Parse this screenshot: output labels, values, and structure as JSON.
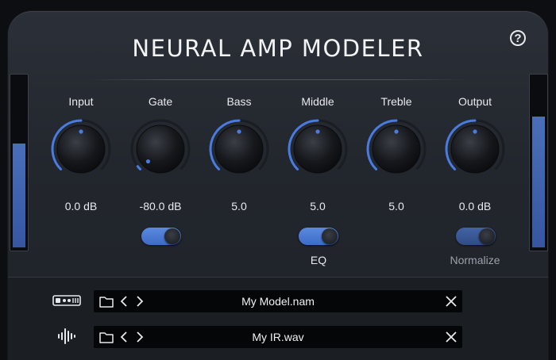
{
  "app": {
    "title": "NEURAL AMP MODELER",
    "help_glyph": "?"
  },
  "colors": {
    "accent": "#4a7be0",
    "knob_arc": "#4a7be0",
    "meter_fill": "#3d5fab",
    "background": "#22262d"
  },
  "meters": {
    "input_level": 0.62,
    "output_level": 0.78
  },
  "knobs": [
    {
      "label": "Input",
      "value": "0.0 dB",
      "level": 0.5
    },
    {
      "label": "Gate",
      "value": "-80.0 dB",
      "level": 0.0
    },
    {
      "label": "Bass",
      "value": "5.0",
      "level": 0.5
    },
    {
      "label": "Middle",
      "value": "5.0",
      "level": 0.5
    },
    {
      "label": "Treble",
      "value": "5.0",
      "level": 0.5
    },
    {
      "label": "Output",
      "value": "0.0 dB",
      "level": 0.5
    }
  ],
  "toggles": {
    "gate": {
      "on": true,
      "label": ""
    },
    "eq": {
      "on": true,
      "label": "EQ"
    },
    "normalize": {
      "on": true,
      "label": "Normalize"
    }
  },
  "model_loader": {
    "icon": "amp-model-icon",
    "filename": "My Model.nam"
  },
  "ir_loader": {
    "icon": "waveform-icon",
    "filename": "My IR.wav"
  },
  "icons": {
    "folder": "folder-icon",
    "prev": "chevron-left-icon",
    "next": "chevron-right-icon",
    "clear": "close-icon"
  }
}
